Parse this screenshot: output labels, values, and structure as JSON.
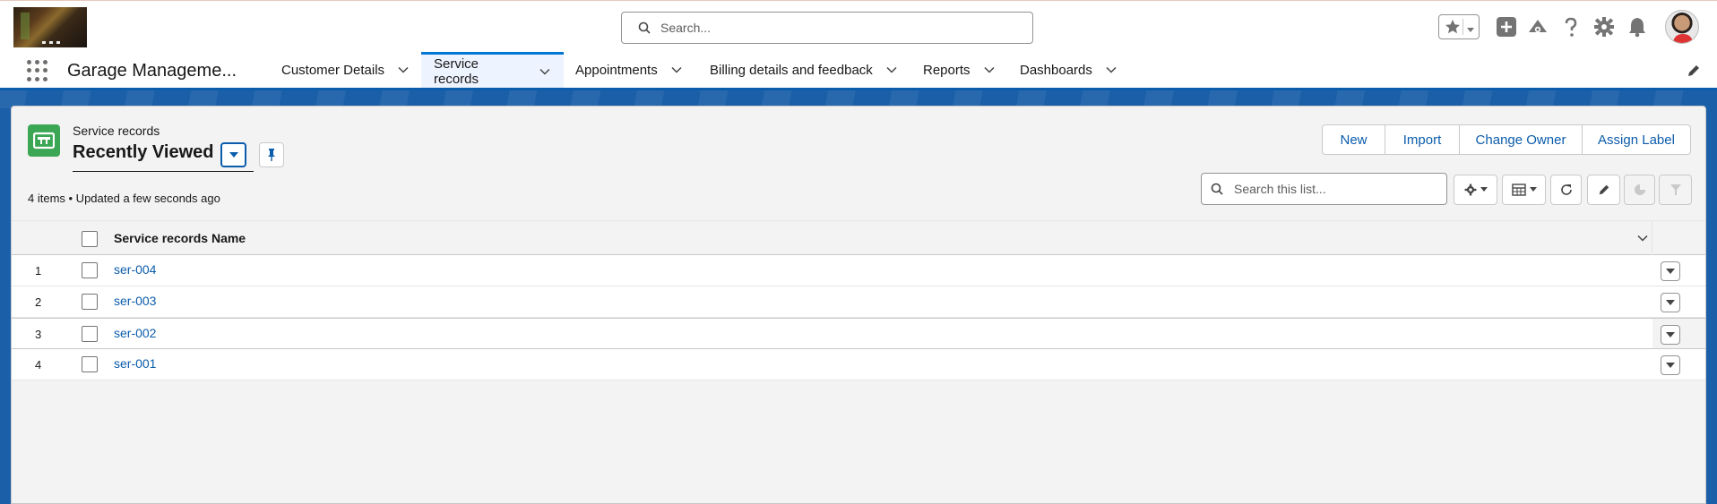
{
  "header": {
    "search_placeholder": "Search..."
  },
  "nav": {
    "app_name": "Garage Manageme...",
    "items": [
      {
        "label": "Customer Details"
      },
      {
        "label": "Service records"
      },
      {
        "label": "Appointments"
      },
      {
        "label": "Billing details and feedback"
      },
      {
        "label": "Reports"
      },
      {
        "label": "Dashboards"
      }
    ]
  },
  "list_view": {
    "object_label": "Service records",
    "view_name": "Recently Viewed",
    "status": "4 items • Updated a few seconds ago",
    "buttons": {
      "new": "New",
      "import": "Import",
      "change_owner": "Change Owner",
      "assign_label": "Assign Label"
    },
    "search_placeholder": "Search this list...",
    "column_header": "Service records Name",
    "rows": [
      {
        "num": "1",
        "name": "ser-004"
      },
      {
        "num": "2",
        "name": "ser-003"
      },
      {
        "num": "3",
        "name": "ser-002"
      },
      {
        "num": "4",
        "name": "ser-001"
      }
    ]
  },
  "colors": {
    "brand_blue": "#0b5cab",
    "object_icon_green": "#3ba755"
  }
}
